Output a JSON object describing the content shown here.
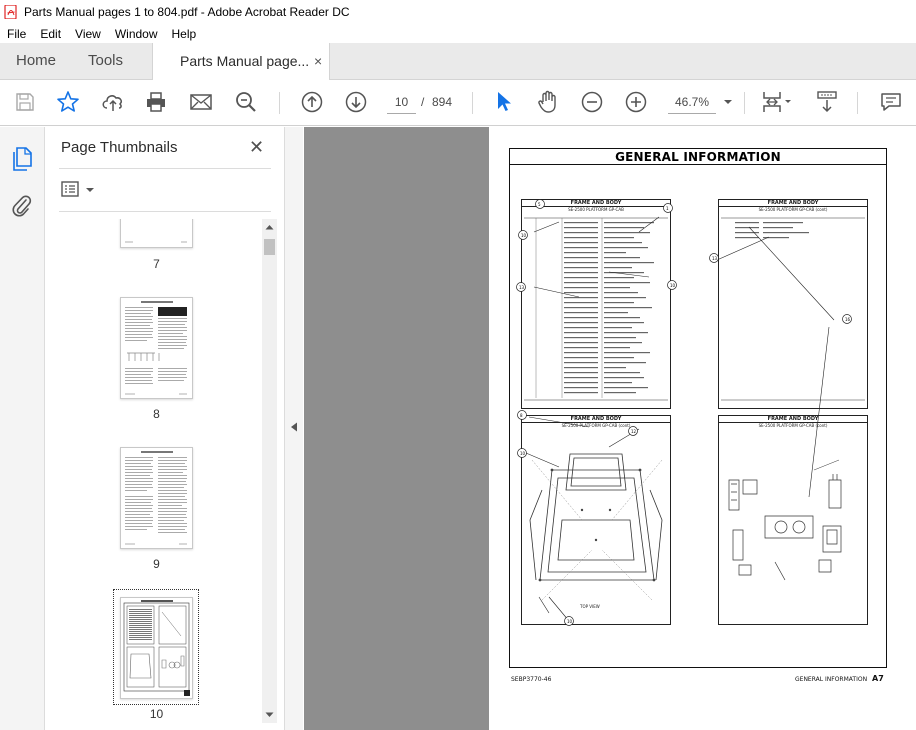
{
  "window": {
    "title": "Parts Manual pages 1 to 804.pdf - Adobe Acrobat Reader DC"
  },
  "menu": [
    "File",
    "Edit",
    "View",
    "Window",
    "Help"
  ],
  "tabs": {
    "home": "Home",
    "tools": "Tools",
    "document": "Parts Manual page...",
    "close_glyph": "×"
  },
  "toolbar": {
    "current_page": "10",
    "separator": "/",
    "total_pages": "894",
    "zoom": "46.7%",
    "icons": [
      "save-icon",
      "bookmark-star-icon",
      "share-upload-icon",
      "print-icon",
      "email-icon",
      "find-icon",
      "prev-page-icon",
      "next-page-icon",
      "select-cursor-icon",
      "hand-icon",
      "zoom-out-icon",
      "zoom-in-icon",
      "zoom-dropdown-icon",
      "page-display-icon",
      "scroll-mode-icon",
      "comment-icon"
    ]
  },
  "left_rail": {
    "icons": [
      "page-thumbnails-icon",
      "attachments-icon"
    ]
  },
  "thumbnails_panel": {
    "title": "Page Thumbnails",
    "close_glyph": "✕",
    "pages": [
      {
        "label": "7"
      },
      {
        "label": "8"
      },
      {
        "label": "9"
      },
      {
        "label": "10",
        "selected": true
      }
    ]
  },
  "document": {
    "title": "GENERAL INFORMATION",
    "footer_left": "SEBP3770-46",
    "footer_right": "GENERAL INFORMATION",
    "footer_page": "A7",
    "panels": [
      {
        "header": "FRAME AND BODY",
        "sub": "SE-2500 PLATFORM GP-CAB"
      },
      {
        "header": "FRAME AND BODY",
        "sub": "SE-2500 PLATFORM GP-CAB (cont)"
      },
      {
        "header": "FRAME AND BODY",
        "sub": "SE-2500 PLATFORM GP-CAB (cont)"
      },
      {
        "header": "FRAME AND BODY",
        "sub": "SE-2500 PLATFORM GP-CAB (cont)"
      }
    ],
    "view_label": "TOP VIEW",
    "callouts": [
      "5",
      "1",
      "10",
      "11",
      "13",
      "10",
      "13",
      "16",
      "8",
      "12",
      "10",
      "10"
    ]
  },
  "colors": {
    "accent_blue": "#1473e6",
    "acrobat_red": "#e02424",
    "doc_bg": "#8e8e8e"
  }
}
